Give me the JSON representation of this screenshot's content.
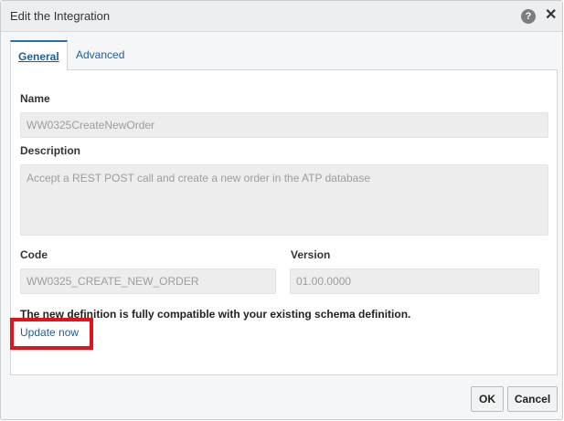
{
  "dialog": {
    "title": "Edit the Integration",
    "help_glyph": "?",
    "close_glyph": "✕"
  },
  "tabs": [
    {
      "label": "General",
      "selected": true
    },
    {
      "label": "Advanced",
      "selected": false
    }
  ],
  "form": {
    "name_label": "Name",
    "name_value": "WW0325CreateNewOrder",
    "description_label": "Description",
    "description_value": "Accept a REST POST call and create a new order in the ATP database",
    "code_label": "Code",
    "code_value": "WW0325_CREATE_NEW_ORDER",
    "version_label": "Version",
    "version_value": "01.00.0000"
  },
  "notice": {
    "message": "The new definition is fully compatible with your existing schema definition.",
    "link_label": "Update now"
  },
  "footer": {
    "ok_label": "OK",
    "cancel_label": "Cancel"
  },
  "colors": {
    "accent": "#1f5d96",
    "highlight": "#e2131b"
  }
}
